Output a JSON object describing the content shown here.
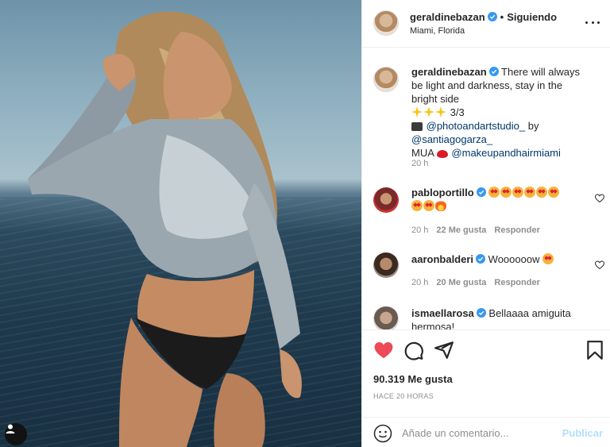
{
  "post": {
    "author": "geraldinebazan",
    "follow_separator": "•",
    "follow_status": "Siguiendo",
    "location": "Miami, Florida",
    "more_icon": "more-horizontal-icon",
    "photo": {
      "description_icon": "user-tags-icon"
    }
  },
  "caption": {
    "user": "geraldinebazan",
    "line1": "There will always be light and darkness, stay in the bright side",
    "sparkles_count_text": "3/3",
    "camera_prefix": "",
    "mention_photo": "@photoandartstudio_",
    "by_text": "by",
    "mention_by": "@santiagogarza_",
    "mua_text": "MUA",
    "mention_mua": "@makeupandhairmiami",
    "time": "20 h"
  },
  "comments": [
    {
      "user": "pabloportillo",
      "verified": true,
      "text": "",
      "emoji_line1_count": 6,
      "time": "20 h",
      "likes": "22 Me gusta",
      "reply": "Responder"
    },
    {
      "user": "aaronbalderi",
      "verified": true,
      "text": "Woooooow",
      "time": "20 h",
      "likes": "20 Me gusta",
      "reply": "Responder"
    },
    {
      "user": "ismaellarosa",
      "verified": true,
      "text": "Bellaaaa amiguita hermosa!"
    }
  ],
  "actions": {
    "like_icon": "heart-filled-icon",
    "comment_icon": "comment-icon",
    "share_icon": "paper-plane-icon",
    "save_icon": "bookmark-icon",
    "likes_text": "90.319 Me gusta",
    "time_ago": "HACE 20 HORAS"
  },
  "add_comment": {
    "placeholder": "Añade un comentario...",
    "publish_label": "Publicar",
    "emoji_icon": "smiley-icon"
  },
  "colors": {
    "verified": "#3897f0",
    "like": "#ed4956",
    "link": "#00376b",
    "muted": "#8e8e8e",
    "publish": "#b2dffc"
  }
}
